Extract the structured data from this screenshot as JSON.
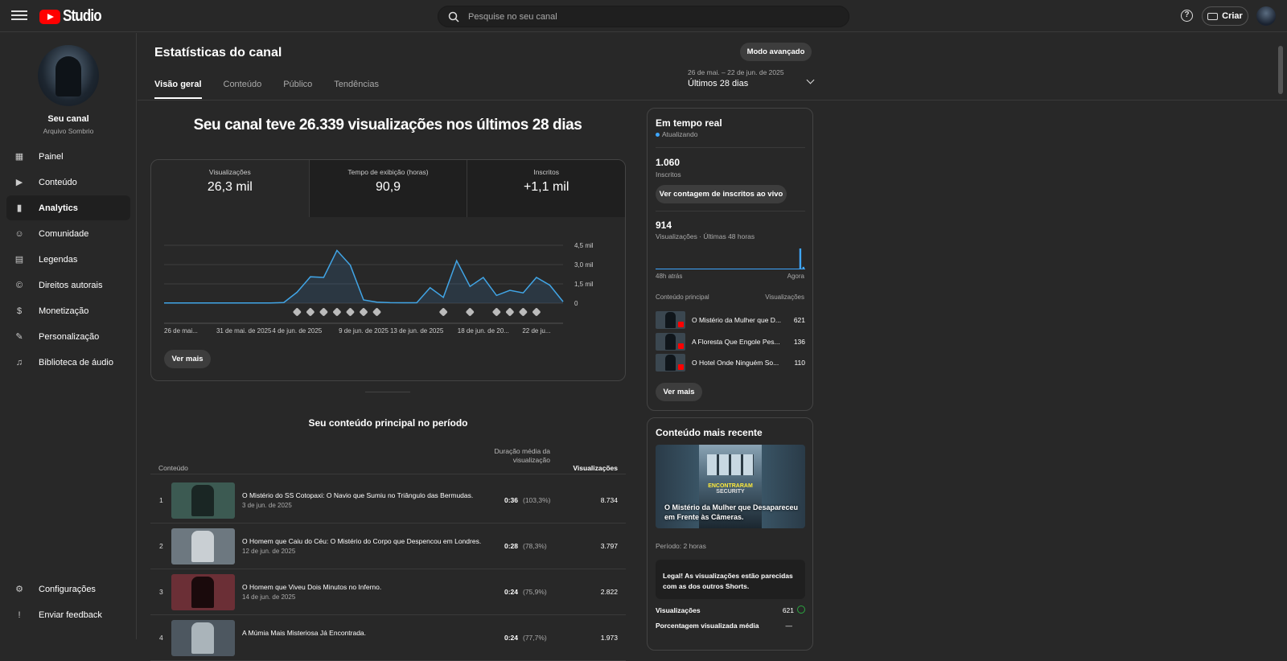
{
  "app": {
    "logo_text": "Studio"
  },
  "search": {
    "placeholder": "Pesquise no seu canal"
  },
  "header": {
    "create_label": "Criar",
    "help_label": "?"
  },
  "channel": {
    "name": "Seu canal",
    "subtitle": "Arquivo Sombrio"
  },
  "nav": [
    {
      "label": "Painel",
      "icon": "dashboard-icon",
      "glyph": "▦"
    },
    {
      "label": "Conteúdo",
      "icon": "content-icon",
      "glyph": "▶"
    },
    {
      "label": "Analytics",
      "icon": "analytics-icon",
      "glyph": "▮"
    },
    {
      "label": "Comunidade",
      "icon": "community-icon",
      "glyph": "☺"
    },
    {
      "label": "Legendas",
      "icon": "subtitles-icon",
      "glyph": "▤"
    },
    {
      "label": "Direitos autorais",
      "icon": "copyright-icon",
      "glyph": "©"
    },
    {
      "label": "Monetização",
      "icon": "monetization-icon",
      "glyph": "$"
    },
    {
      "label": "Personalização",
      "icon": "customization-icon",
      "glyph": "✎"
    },
    {
      "label": "Biblioteca de áudio",
      "icon": "audio-library-icon",
      "glyph": "♫"
    }
  ],
  "nav_bottom": [
    {
      "label": "Configurações",
      "icon": "settings-icon",
      "glyph": "⚙"
    },
    {
      "label": "Enviar feedback",
      "icon": "feedback-icon",
      "glyph": "!"
    }
  ],
  "page": {
    "title": "Estatísticas do canal",
    "advanced_mode": "Modo avançado",
    "tabs": [
      "Visão geral",
      "Conteúdo",
      "Público",
      "Tendências"
    ],
    "date_range": "26 de mai. – 22 de jun. de 2025",
    "period": "Últimos 28 dias",
    "headline": "Seu canal teve 26.339 visualizações nos últimos 28 dias"
  },
  "metrics": [
    {
      "label": "Visualizações",
      "value": "26,3 mil"
    },
    {
      "label": "Tempo de exibição (horas)",
      "value": "90,9"
    },
    {
      "label": "Inscritos",
      "value": "+1,1 mil"
    }
  ],
  "chart_data": {
    "type": "area",
    "x_tick_labels": [
      "26 de mai...",
      "31 de mai. de 2025",
      "4 de jun. de 2025",
      "9 de jun. de 2025",
      "13 de jun. de 2025",
      "18 de jun. de 20...",
      "22 de ju..."
    ],
    "y_tick_labels": [
      "4,5 mil",
      "3,0 mil",
      "1,5 mil",
      "0"
    ],
    "ylim": [
      0,
      4500
    ],
    "values": [
      20,
      20,
      20,
      20,
      20,
      20,
      20,
      20,
      20,
      50,
      850,
      2050,
      2000,
      4100,
      2950,
      250,
      80,
      40,
      30,
      30,
      1200,
      450,
      3300,
      1300,
      2000,
      600,
      1000,
      800,
      2000,
      1400,
      120
    ],
    "video_markers": [
      10,
      11,
      12,
      13,
      14,
      15,
      16,
      21,
      23,
      25,
      26,
      27,
      28
    ],
    "grid": true,
    "view_more": "Ver mais"
  },
  "top_content": {
    "title": "Seu conteúdo principal no período",
    "col_content": "Conteúdo",
    "col_duration": "Duração média da visualização",
    "col_views": "Visualizações",
    "rows": [
      {
        "num": "1",
        "title": "O Mistério do SS Cotopaxi: O Navio que Sumiu no Triângulo das Bermudas.",
        "date": "3 de jun. de 2025",
        "duration": "0:36",
        "pct": "(103,3%)",
        "views": "8.734",
        "thumb_color": "#3c5a52",
        "fig_color": "#1a2624"
      },
      {
        "num": "2",
        "title": "O Homem que Caiu do Céu: O Mistério do Corpo que Despencou em Londres.",
        "date": "12 de jun. de 2025",
        "duration": "0:28",
        "pct": "(78,3%)",
        "views": "3.797",
        "thumb_color": "#6d7880",
        "fig_color": "#c9cfd3"
      },
      {
        "num": "3",
        "title": "O Homem que Viveu Dois Minutos no Inferno.",
        "date": "14 de jun. de 2025",
        "duration": "0:24",
        "pct": "(75,9%)",
        "views": "2.822",
        "thumb_color": "#6b2f36",
        "fig_color": "#1a0a0c"
      },
      {
        "num": "4",
        "title": "A Múmia Mais Misteriosa Já Encontrada.",
        "date": "",
        "duration": "0:24",
        "pct": "(77,7%)",
        "views": "1.973",
        "thumb_color": "#4d5760",
        "fig_color": "#aab4ba"
      }
    ]
  },
  "realtime": {
    "title": "Em tempo real",
    "status": "Atualizando",
    "subscribers": "1.060",
    "subscribers_label": "Inscritos",
    "live_count_button": "Ver contagem de inscritos ao vivo",
    "views": "914",
    "views_label": "Visualizações · Últimas 48 horas",
    "bars": [
      0.04,
      0.02,
      0.02,
      0.03,
      0.02,
      0.02,
      0.02,
      0.02,
      0.02,
      0.02,
      0.02,
      0.02,
      0.02,
      0.02,
      0.02,
      0.02,
      0.02,
      0.02,
      0.02,
      0.02,
      0.02,
      0.02,
      0.02,
      0.02,
      0.02,
      0.02,
      0.02,
      0.03,
      0.02,
      0.02,
      0.02,
      0.02,
      0.02,
      0.02,
      0.02,
      0.02,
      0.02,
      0.02,
      0.02,
      0.02,
      0.02,
      0.02,
      0.02,
      0.02,
      0.02,
      0.02,
      1.0,
      0.12
    ],
    "axis_left": "48h atrás",
    "axis_right": "Agora",
    "col_content": "Conteúdo principal",
    "col_views": "Visualizações",
    "items": [
      {
        "title": "O Mistério da Mulher que D...",
        "views": "621"
      },
      {
        "title": "A Floresta Que Engole Pes...",
        "views": "136"
      },
      {
        "title": "O Hotel Onde Ninguém So...",
        "views": "110"
      }
    ],
    "view_more": "Ver mais"
  },
  "recent": {
    "title": "Conteúdo mais recente",
    "thumb_caption": "ENCONTRARAM",
    "thumb_caption2": "SECURITY",
    "video_title": "O Mistério da Mulher que Desapareceu em Frente às Câmeras.",
    "period": "Período: 2 horas",
    "message": "Legal! As visualizações estão parecidas com as dos outros Shorts.",
    "stats": [
      {
        "label": "Visualizações",
        "value": "621"
      },
      {
        "label": "Porcentagem visualizada média",
        "value": "—"
      }
    ]
  }
}
